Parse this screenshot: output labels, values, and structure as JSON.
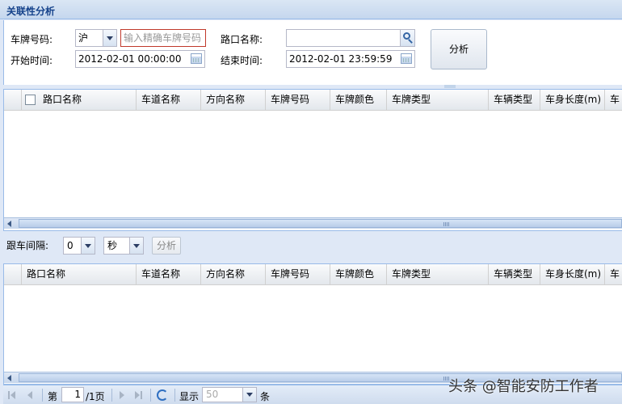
{
  "panel": {
    "title": "关联性分析"
  },
  "form": {
    "plate_label": "车牌号码:",
    "province_value": "沪",
    "plate_placeholder": "输入精确车牌号码",
    "crossing_label": "路口名称:",
    "crossing_value": "",
    "start_label": "开始时间:",
    "start_value": "2012-02-01 00:00:00",
    "end_label": "结束时间:",
    "end_value": "2012-02-01 23:59:59",
    "analyze_label": "分析"
  },
  "grid1": {
    "columns": [
      "路口名称",
      "车道名称",
      "方向名称",
      "车牌号码",
      "车牌颜色",
      "车牌类型",
      "车辆类型",
      "车身长度(m)",
      "车"
    ]
  },
  "follow": {
    "label": "跟车间隔:",
    "interval_value": "0",
    "unit_value": "秒",
    "analyze_label": "分析"
  },
  "grid2": {
    "columns": [
      "路口名称",
      "车道名称",
      "方向名称",
      "车牌号码",
      "车牌颜色",
      "车牌类型",
      "车辆类型",
      "车身长度(m)",
      "车"
    ]
  },
  "pager": {
    "page_prefix": "第",
    "page_value": "1",
    "page_suffix": "/1页",
    "show_label": "显示",
    "page_size": "50",
    "unit": "条"
  },
  "watermark": "头条 @智能安防工作者"
}
